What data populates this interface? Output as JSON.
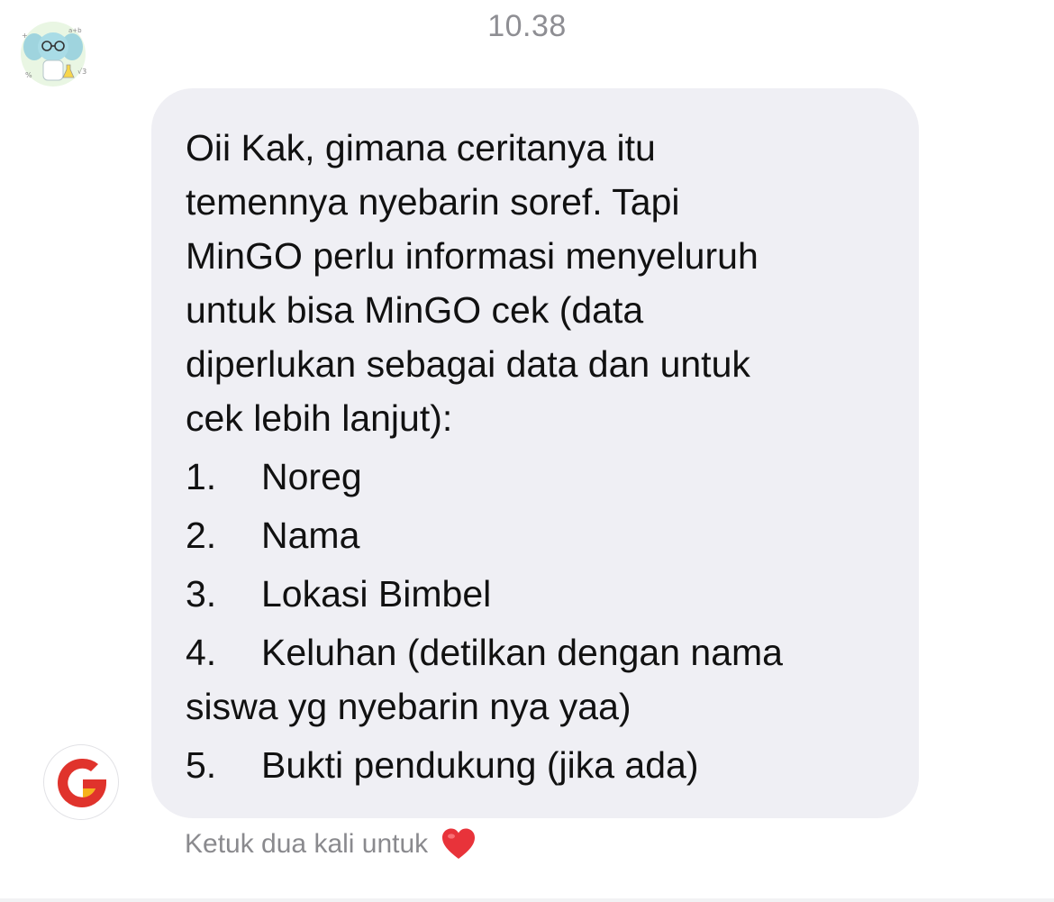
{
  "header": {
    "timestamp": "10.38"
  },
  "chat": {
    "sticker_icon": "elephant-scientist-sticker",
    "sender_avatar_icon": "g-logo-avatar",
    "message": {
      "intro": "Oii Kak, gimana ceritanya itu\ntemennya nyebarin soref. Tapi\nMinGO perlu informasi menyeluruh\nuntuk bisa MinGO cek (data\ndiperlukan sebagai data dan untuk\ncek lebih lanjut):",
      "items": [
        {
          "num": "1.",
          "text": "Noreg"
        },
        {
          "num": "2.",
          "text": "Nama"
        },
        {
          "num": "3.",
          "text": "Lokasi Bimbel"
        },
        {
          "num": "4.",
          "text": "Keluhan (detilkan dengan nama"
        },
        {
          "num": "",
          "text": "siswa yg nyebarin nya yaa)"
        },
        {
          "num": "5.",
          "text": "Bukti pendukung (jika ada)"
        }
      ]
    },
    "hint": {
      "text": "Ketuk dua kali untuk",
      "icon": "heart-icon"
    }
  },
  "colors": {
    "bubble": "#efeff4",
    "text": "#111111",
    "meta_text": "#8e8e93",
    "logo_red": "#e0332c",
    "logo_yellow": "#f6b21b",
    "heart": "#e8333a"
  }
}
